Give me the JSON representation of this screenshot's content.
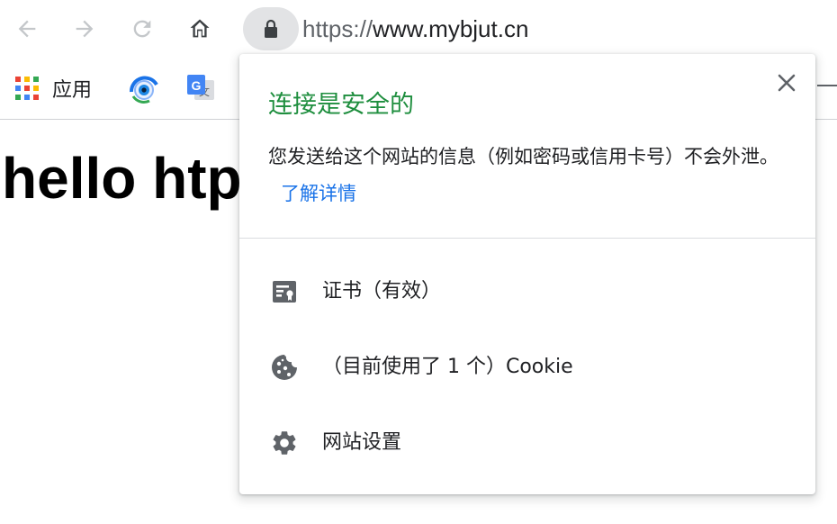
{
  "toolbar": {
    "back_icon": "arrow-left-icon",
    "forward_icon": "arrow-right-icon",
    "reload_icon": "reload-icon",
    "home_icon": "home-icon",
    "lock_icon": "lock-icon",
    "url_scheme": "https://",
    "url_host": "www.mybjut.cn"
  },
  "bookmarks": {
    "apps_label": "应用"
  },
  "page": {
    "heading": "hello htp"
  },
  "popup": {
    "title": "连接是安全的",
    "description": "您发送给这个网站的信息（例如密码或信用卡号）不会外泄。",
    "learn_more": "了解详情",
    "items": [
      {
        "icon": "certificate-icon",
        "label": "证书（有效）"
      },
      {
        "icon": "cookie-icon",
        "label": "（目前使用了 1 个）Cookie"
      },
      {
        "icon": "gear-icon",
        "label": "网站设置"
      }
    ]
  },
  "colors": {
    "secure_green": "#1e8e3e",
    "link_blue": "#1a73e8",
    "icon_gray": "#5f6368",
    "omnibox_chip": "#e2e3e5"
  }
}
